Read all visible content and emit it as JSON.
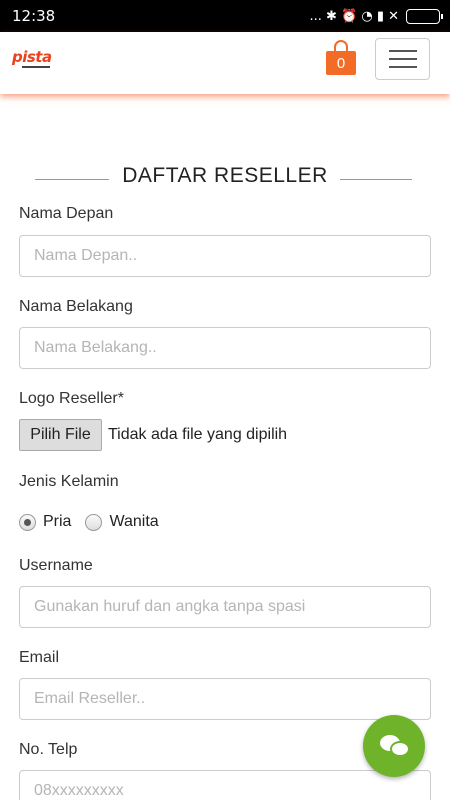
{
  "status_bar": {
    "time": "12:38",
    "icons_text": "... ✱ ⏰ ◔ ▮ ✕"
  },
  "header": {
    "logo_text": "pista",
    "cart_count": "0"
  },
  "form": {
    "title": "DAFTAR RESELLER",
    "first_name": {
      "label": "Nama Depan",
      "placeholder": "Nama Depan.."
    },
    "last_name": {
      "label": "Nama Belakang",
      "placeholder": "Nama Belakang.."
    },
    "logo": {
      "label": "Logo Reseller*",
      "button": "Pilih File",
      "status": "Tidak ada file yang dipilih"
    },
    "gender": {
      "label": "Jenis Kelamin",
      "option_male": "Pria",
      "option_female": "Wanita",
      "selected": "Pria"
    },
    "username": {
      "label": "Username",
      "placeholder": "Gunakan huruf dan angka tanpa spasi"
    },
    "email": {
      "label": "Email",
      "placeholder": "Email Reseller.."
    },
    "phone": {
      "label": "No. Telp",
      "placeholder": "08xxxxxxxxx"
    }
  },
  "colors": {
    "accent": "#f26c28",
    "logo": "#e8431c",
    "chat": "#6fb32a"
  },
  "icons": {
    "cart": "shopping-bag-icon",
    "menu": "hamburger-icon",
    "chat": "chat-bubbles-icon"
  }
}
